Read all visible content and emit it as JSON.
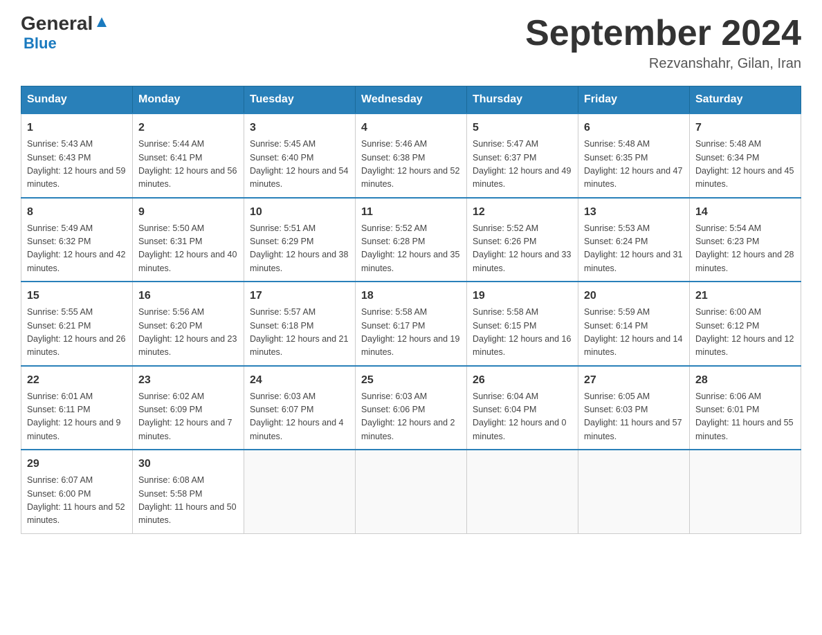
{
  "header": {
    "logo_main": "General",
    "logo_blue": "Blue",
    "month_title": "September 2024",
    "subtitle": "Rezvanshahr, Gilan, Iran"
  },
  "days_of_week": [
    "Sunday",
    "Monday",
    "Tuesday",
    "Wednesday",
    "Thursday",
    "Friday",
    "Saturday"
  ],
  "weeks": [
    [
      {
        "day": "1",
        "sunrise": "5:43 AM",
        "sunset": "6:43 PM",
        "daylight": "12 hours and 59 minutes."
      },
      {
        "day": "2",
        "sunrise": "5:44 AM",
        "sunset": "6:41 PM",
        "daylight": "12 hours and 56 minutes."
      },
      {
        "day": "3",
        "sunrise": "5:45 AM",
        "sunset": "6:40 PM",
        "daylight": "12 hours and 54 minutes."
      },
      {
        "day": "4",
        "sunrise": "5:46 AM",
        "sunset": "6:38 PM",
        "daylight": "12 hours and 52 minutes."
      },
      {
        "day": "5",
        "sunrise": "5:47 AM",
        "sunset": "6:37 PM",
        "daylight": "12 hours and 49 minutes."
      },
      {
        "day": "6",
        "sunrise": "5:48 AM",
        "sunset": "6:35 PM",
        "daylight": "12 hours and 47 minutes."
      },
      {
        "day": "7",
        "sunrise": "5:48 AM",
        "sunset": "6:34 PM",
        "daylight": "12 hours and 45 minutes."
      }
    ],
    [
      {
        "day": "8",
        "sunrise": "5:49 AM",
        "sunset": "6:32 PM",
        "daylight": "12 hours and 42 minutes."
      },
      {
        "day": "9",
        "sunrise": "5:50 AM",
        "sunset": "6:31 PM",
        "daylight": "12 hours and 40 minutes."
      },
      {
        "day": "10",
        "sunrise": "5:51 AM",
        "sunset": "6:29 PM",
        "daylight": "12 hours and 38 minutes."
      },
      {
        "day": "11",
        "sunrise": "5:52 AM",
        "sunset": "6:28 PM",
        "daylight": "12 hours and 35 minutes."
      },
      {
        "day": "12",
        "sunrise": "5:52 AM",
        "sunset": "6:26 PM",
        "daylight": "12 hours and 33 minutes."
      },
      {
        "day": "13",
        "sunrise": "5:53 AM",
        "sunset": "6:24 PM",
        "daylight": "12 hours and 31 minutes."
      },
      {
        "day": "14",
        "sunrise": "5:54 AM",
        "sunset": "6:23 PM",
        "daylight": "12 hours and 28 minutes."
      }
    ],
    [
      {
        "day": "15",
        "sunrise": "5:55 AM",
        "sunset": "6:21 PM",
        "daylight": "12 hours and 26 minutes."
      },
      {
        "day": "16",
        "sunrise": "5:56 AM",
        "sunset": "6:20 PM",
        "daylight": "12 hours and 23 minutes."
      },
      {
        "day": "17",
        "sunrise": "5:57 AM",
        "sunset": "6:18 PM",
        "daylight": "12 hours and 21 minutes."
      },
      {
        "day": "18",
        "sunrise": "5:58 AM",
        "sunset": "6:17 PM",
        "daylight": "12 hours and 19 minutes."
      },
      {
        "day": "19",
        "sunrise": "5:58 AM",
        "sunset": "6:15 PM",
        "daylight": "12 hours and 16 minutes."
      },
      {
        "day": "20",
        "sunrise": "5:59 AM",
        "sunset": "6:14 PM",
        "daylight": "12 hours and 14 minutes."
      },
      {
        "day": "21",
        "sunrise": "6:00 AM",
        "sunset": "6:12 PM",
        "daylight": "12 hours and 12 minutes."
      }
    ],
    [
      {
        "day": "22",
        "sunrise": "6:01 AM",
        "sunset": "6:11 PM",
        "daylight": "12 hours and 9 minutes."
      },
      {
        "day": "23",
        "sunrise": "6:02 AM",
        "sunset": "6:09 PM",
        "daylight": "12 hours and 7 minutes."
      },
      {
        "day": "24",
        "sunrise": "6:03 AM",
        "sunset": "6:07 PM",
        "daylight": "12 hours and 4 minutes."
      },
      {
        "day": "25",
        "sunrise": "6:03 AM",
        "sunset": "6:06 PM",
        "daylight": "12 hours and 2 minutes."
      },
      {
        "day": "26",
        "sunrise": "6:04 AM",
        "sunset": "6:04 PM",
        "daylight": "12 hours and 0 minutes."
      },
      {
        "day": "27",
        "sunrise": "6:05 AM",
        "sunset": "6:03 PM",
        "daylight": "11 hours and 57 minutes."
      },
      {
        "day": "28",
        "sunrise": "6:06 AM",
        "sunset": "6:01 PM",
        "daylight": "11 hours and 55 minutes."
      }
    ],
    [
      {
        "day": "29",
        "sunrise": "6:07 AM",
        "sunset": "6:00 PM",
        "daylight": "11 hours and 52 minutes."
      },
      {
        "day": "30",
        "sunrise": "6:08 AM",
        "sunset": "5:58 PM",
        "daylight": "11 hours and 50 minutes."
      },
      null,
      null,
      null,
      null,
      null
    ]
  ],
  "labels": {
    "sunrise": "Sunrise:",
    "sunset": "Sunset:",
    "daylight": "Daylight:"
  }
}
